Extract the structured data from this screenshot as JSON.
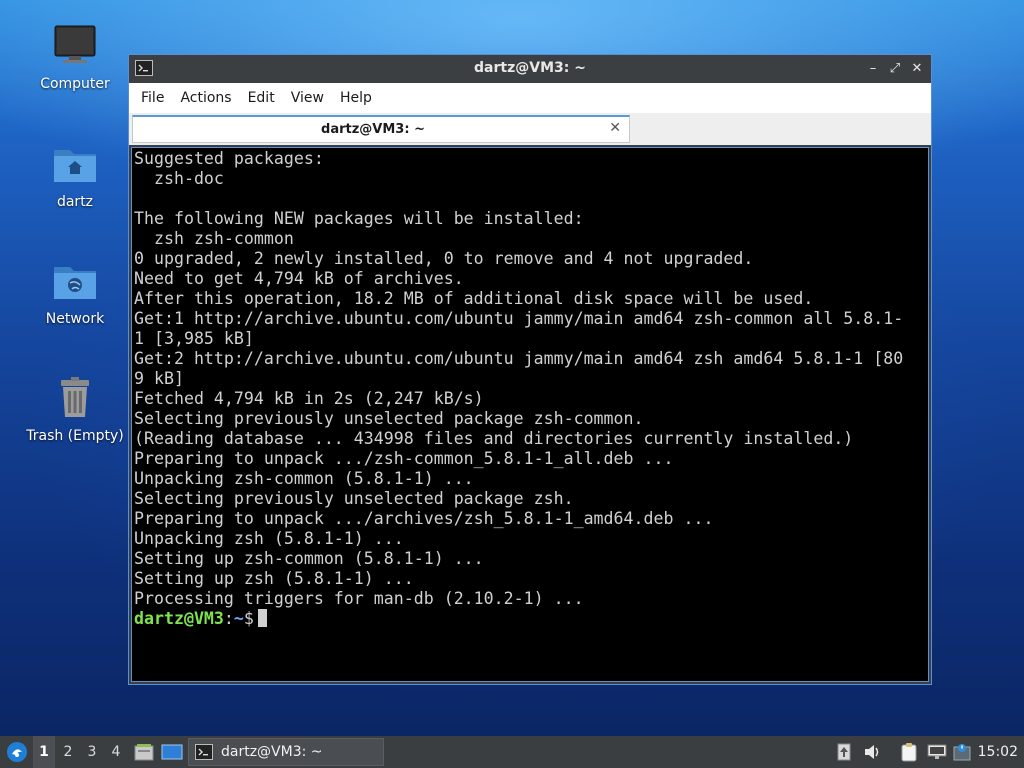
{
  "desktop": {
    "icons": [
      {
        "label": "Computer"
      },
      {
        "label": "dartz"
      },
      {
        "label": "Network"
      },
      {
        "label": "Trash (Empty)"
      }
    ]
  },
  "window": {
    "title": "dartz@VM3: ~",
    "controls": {
      "minimize": "–",
      "restore": "⤢",
      "close": "✕"
    },
    "menu": [
      "File",
      "Actions",
      "Edit",
      "View",
      "Help"
    ],
    "tab": {
      "label": "dartz@VM3: ~",
      "close": "✕"
    }
  },
  "terminal": {
    "lines": [
      "Suggested packages:",
      "  zsh-doc",
      "",
      "The following NEW packages will be installed:",
      "  zsh zsh-common",
      "0 upgraded, 2 newly installed, 0 to remove and 4 not upgraded.",
      "Need to get 4,794 kB of archives.",
      "After this operation, 18.2 MB of additional disk space will be used.",
      "Get:1 http://archive.ubuntu.com/ubuntu jammy/main amd64 zsh-common all 5.8.1-",
      "1 [3,985 kB]",
      "Get:2 http://archive.ubuntu.com/ubuntu jammy/main amd64 zsh amd64 5.8.1-1 [80",
      "9 kB]",
      "Fetched 4,794 kB in 2s (2,247 kB/s)",
      "Selecting previously unselected package zsh-common.",
      "(Reading database ... 434998 files and directories currently installed.)",
      "Preparing to unpack .../zsh-common_5.8.1-1_all.deb ...",
      "Unpacking zsh-common (5.8.1-1) ...",
      "Selecting previously unselected package zsh.",
      "Preparing to unpack .../archives/zsh_5.8.1-1_amd64.deb ...",
      "Unpacking zsh (5.8.1-1) ...",
      "Setting up zsh-common (5.8.1-1) ...",
      "Setting up zsh (5.8.1-1) ...",
      "Processing triggers for man-db (2.10.2-1) ..."
    ],
    "prompt": {
      "user": "dartz@VM3",
      "sep": ":",
      "path": "~",
      "symbol": "$"
    }
  },
  "taskbar": {
    "workspaces": [
      "1",
      "2",
      "3",
      "4"
    ],
    "active_workspace": "1",
    "task_label": "dartz@VM3: ~",
    "clock": "15:02"
  },
  "colors": {
    "terminal_bg": "#000000",
    "terminal_fg": "#d0d0d0",
    "prompt_user": "#7ee34e",
    "prompt_path": "#6fa6ff",
    "window_accent": "#5b8fd4"
  }
}
